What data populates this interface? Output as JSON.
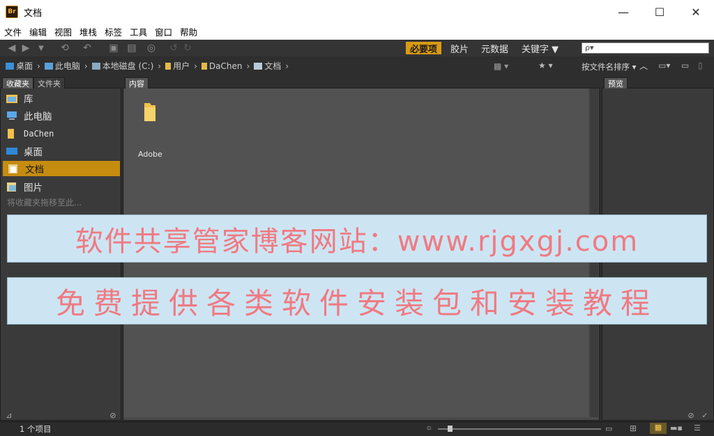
{
  "window": {
    "app_icon_text": "Br",
    "title": "文档",
    "minimize": "—",
    "maximize": "☐",
    "close": "✕"
  },
  "menu": [
    "文件",
    "编辑",
    "视图",
    "堆栈",
    "标签",
    "工具",
    "窗口",
    "帮助"
  ],
  "workspaces": {
    "essentials": "必要项",
    "filmstrip": "胶片",
    "metadata": "元数据",
    "keywords": "关键字 ▼"
  },
  "search": {
    "placeholder": "ρ▾"
  },
  "breadcrumb": [
    "桌面",
    "此电脑",
    "本地磁盘 (C:)",
    "用户",
    "DaChen",
    "文档"
  ],
  "sort_label": "按文件名排序 ▾",
  "tabs": {
    "favorites": "收藏夹",
    "folders": "文件夹",
    "content": "内容",
    "preview": "预览"
  },
  "favorites": [
    {
      "label": "库",
      "icon": "library-icon"
    },
    {
      "label": "此电脑",
      "icon": "computer-icon"
    },
    {
      "label": "DaChen",
      "icon": "user-folder-icon"
    },
    {
      "label": "桌面",
      "icon": "desktop-icon"
    },
    {
      "label": "文档",
      "icon": "documents-icon",
      "selected": true
    },
    {
      "label": "图片",
      "icon": "pictures-icon"
    }
  ],
  "favorites_hint": "将收藏夹拖移至此...",
  "content_items": [
    {
      "name": "Adobe",
      "icon": "folder-icon"
    }
  ],
  "banner": {
    "line1": "软件共享管家博客网站：www.rjgxgj.com",
    "line2": "免费提供各类软件安装包和安装教程"
  },
  "status": {
    "items_count": "1 个项目"
  },
  "zoom": {
    "level_fraction": 0.06
  },
  "colors": {
    "accent": "#d99a14",
    "banner_bg": "#cde5f3",
    "banner_text": "#f07a82",
    "content_bg": "#525252"
  }
}
